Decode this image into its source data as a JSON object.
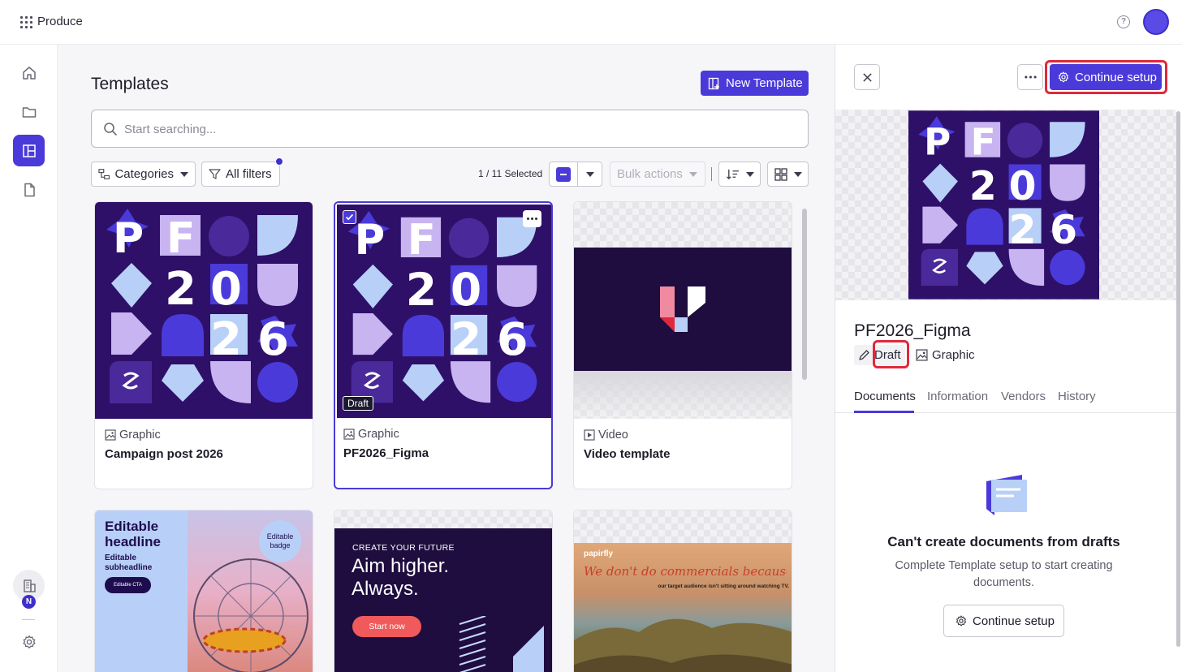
{
  "app": {
    "name": "Produce"
  },
  "rail": {
    "badge": "N"
  },
  "page": {
    "title": "Templates",
    "new_template_label": "New Template"
  },
  "search": {
    "placeholder": "Start searching..."
  },
  "filters": {
    "categories_label": "Categories",
    "all_filters_label": "All filters",
    "selected_count": "1 / 11 Selected",
    "bulk_actions_label": "Bulk actions"
  },
  "templates": [
    {
      "type": "Graphic",
      "name": "Campaign post 2026",
      "status": "",
      "selected": false
    },
    {
      "type": "Graphic",
      "name": "PF2026_Figma",
      "status": "Draft",
      "selected": true
    },
    {
      "type": "Video",
      "name": "Video template",
      "status": "",
      "selected": false
    }
  ],
  "thumb_text": {
    "pf": {
      "p": "P",
      "f": "F",
      "d2a": "2",
      "d0": "0",
      "d2b": "2",
      "d6": "6"
    },
    "editable": {
      "headline": "Editable headline",
      "subheadline": "Editable subheadline",
      "cta": "Editable CTA",
      "badge": "Editable badge"
    },
    "aim": {
      "kicker": "CREATE YOUR FUTURE",
      "headline": "Aim higher. Always.",
      "cta": "Start now"
    },
    "papirfly": {
      "brand": "papirfly",
      "headline": "We don't do commercials because...",
      "sub": "our target audience isn't sitting around watching TV."
    }
  },
  "panel": {
    "continue_label": "Continue setup",
    "title": "PF2026_Figma",
    "status": "Draft",
    "type": "Graphic",
    "tabs": [
      "Documents",
      "Information",
      "Vendors",
      "History"
    ],
    "empty_title": "Can't create documents from drafts",
    "empty_sub": "Complete Template setup to start creating documents.",
    "continue_bottom_label": "Continue setup"
  },
  "colors": {
    "accent": "#4a3ad9",
    "highlight": "#e0283c",
    "thumb_bg": "#2e1068"
  }
}
